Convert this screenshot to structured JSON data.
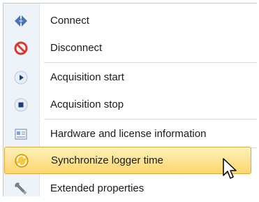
{
  "menu": {
    "items": [
      {
        "label": "Connect",
        "icon": "connect-icon"
      },
      {
        "label": "Disconnect",
        "icon": "disconnect-icon"
      },
      {
        "label": "Acquisition start",
        "icon": "play-icon"
      },
      {
        "label": "Acquisition stop",
        "icon": "stop-icon"
      },
      {
        "label": "Hardware and license information",
        "icon": "info-card-icon"
      },
      {
        "label": "Synchronize logger time",
        "icon": "clock-sync-icon"
      },
      {
        "label": "Extended properties",
        "icon": "wrench-icon"
      }
    ],
    "highlighted_index": 5
  },
  "colors": {
    "highlight_top": "#fdf1b9",
    "highlight_bottom": "#fbd66e",
    "gutter": "#eef3fa"
  }
}
